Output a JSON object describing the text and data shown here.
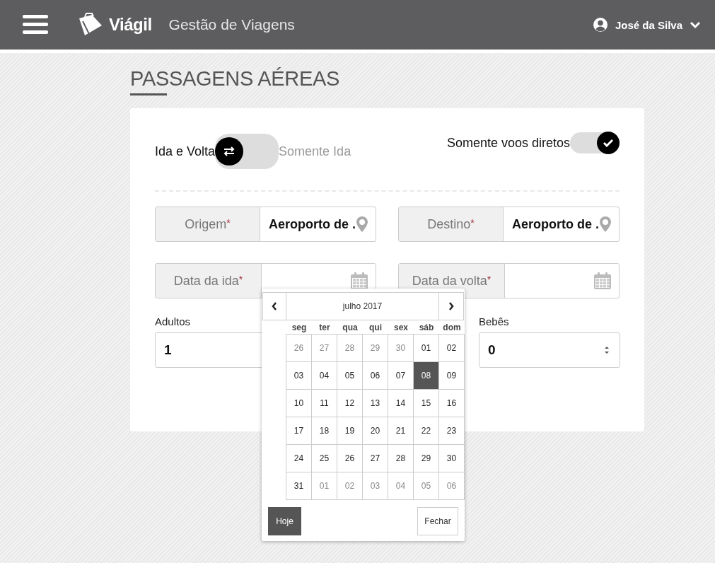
{
  "header": {
    "brand": "Viágil",
    "subtitle": "Gestão de Viagens",
    "user": "José da Silva"
  },
  "title": "PASSAGENS AÉREAS",
  "trip_type": [
    {
      "label": "Ida e Volta",
      "selected": true
    },
    {
      "label": "Somente Ida",
      "selected": false
    }
  ],
  "direct_only": {
    "label": "Somente voos diretos",
    "checked": true
  },
  "fields": [
    {
      "kind": "place",
      "label": "Origem",
      "required_mark": "*",
      "value": "Aeroporto de ."
    },
    {
      "kind": "place",
      "label": "Destino",
      "required_mark": "*",
      "value": "Aeroporto de ."
    },
    {
      "kind": "date",
      "label": "Data da ida",
      "required_mark": "*"
    },
    {
      "kind": "date",
      "label": "Data da volta",
      "required_mark": "*"
    }
  ],
  "passengers": [
    {
      "kind": "plain",
      "label": "Adultos",
      "value": "1"
    },
    {
      "kind": "hidden"
    },
    {
      "kind": "spinner",
      "label": "Bebês",
      "value": "0"
    }
  ],
  "calendar": {
    "month": "julho 2017",
    "weekdays": [
      "seg",
      "ter",
      "qua",
      "qui",
      "sex",
      "sáb",
      "dom"
    ],
    "weeks": [
      [
        {
          "day": "26",
          "muted": true,
          "selected": false
        },
        {
          "day": "27",
          "muted": true,
          "selected": false
        },
        {
          "day": "28",
          "muted": true,
          "selected": false
        },
        {
          "day": "29",
          "muted": true,
          "selected": false
        },
        {
          "day": "30",
          "muted": true,
          "selected": false
        },
        {
          "day": "01",
          "muted": false,
          "selected": false
        },
        {
          "day": "02",
          "muted": false,
          "selected": false
        }
      ],
      [
        {
          "day": "03",
          "muted": false,
          "selected": false
        },
        {
          "day": "04",
          "muted": false,
          "selected": false
        },
        {
          "day": "05",
          "muted": false,
          "selected": false
        },
        {
          "day": "06",
          "muted": false,
          "selected": false
        },
        {
          "day": "07",
          "muted": false,
          "selected": false
        },
        {
          "day": "08",
          "muted": false,
          "selected": true
        },
        {
          "day": "09",
          "muted": false,
          "selected": false
        }
      ],
      [
        {
          "day": "10",
          "muted": false,
          "selected": false
        },
        {
          "day": "11",
          "muted": false,
          "selected": false
        },
        {
          "day": "12",
          "muted": false,
          "selected": false
        },
        {
          "day": "13",
          "muted": false,
          "selected": false
        },
        {
          "day": "14",
          "muted": false,
          "selected": false
        },
        {
          "day": "15",
          "muted": false,
          "selected": false
        },
        {
          "day": "16",
          "muted": false,
          "selected": false
        }
      ],
      [
        {
          "day": "17",
          "muted": false,
          "selected": false
        },
        {
          "day": "18",
          "muted": false,
          "selected": false
        },
        {
          "day": "19",
          "muted": false,
          "selected": false
        },
        {
          "day": "20",
          "muted": false,
          "selected": false
        },
        {
          "day": "21",
          "muted": false,
          "selected": false
        },
        {
          "day": "22",
          "muted": false,
          "selected": false
        },
        {
          "day": "23",
          "muted": false,
          "selected": false
        }
      ],
      [
        {
          "day": "24",
          "muted": false,
          "selected": false
        },
        {
          "day": "25",
          "muted": false,
          "selected": false
        },
        {
          "day": "26",
          "muted": false,
          "selected": false
        },
        {
          "day": "27",
          "muted": false,
          "selected": false
        },
        {
          "day": "28",
          "muted": false,
          "selected": false
        },
        {
          "day": "29",
          "muted": false,
          "selected": false
        },
        {
          "day": "30",
          "muted": false,
          "selected": false
        }
      ],
      [
        {
          "day": "31",
          "muted": false,
          "selected": false
        },
        {
          "day": "01",
          "muted": true,
          "selected": false
        },
        {
          "day": "02",
          "muted": true,
          "selected": false
        },
        {
          "day": "03",
          "muted": true,
          "selected": false
        },
        {
          "day": "04",
          "muted": true,
          "selected": false
        },
        {
          "day": "05",
          "muted": true,
          "selected": false
        },
        {
          "day": "06",
          "muted": true,
          "selected": false
        }
      ]
    ],
    "today_button": "Hoje",
    "close_button": "Fechar"
  }
}
